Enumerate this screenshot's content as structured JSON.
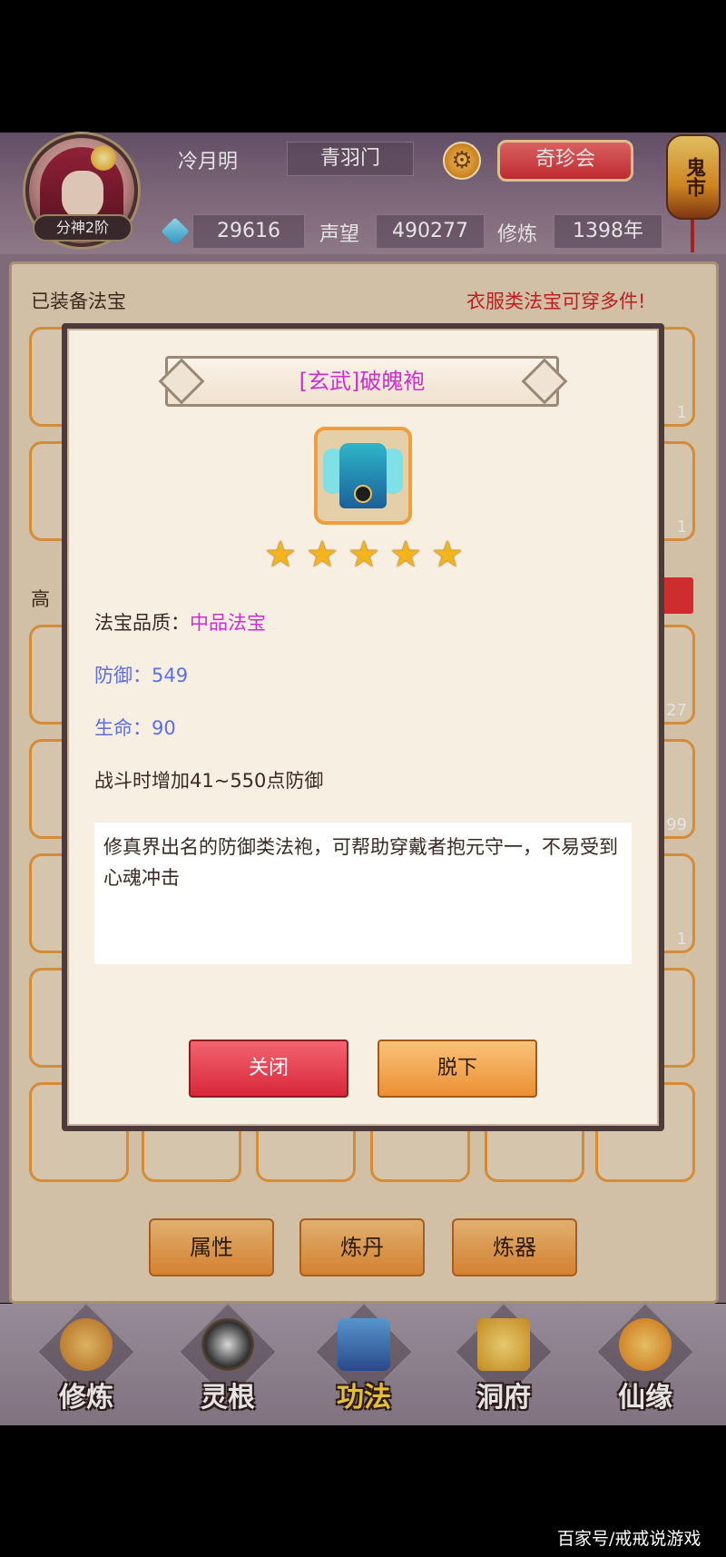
{
  "header": {
    "player_name": "冷月明",
    "sect": "青羽门",
    "rank": "分神2阶",
    "treasure_button": "奇珍会",
    "lantern_text": "鬼市",
    "gems": "29616",
    "reputation_label": "声望",
    "reputation_value": "490277",
    "cultivation_label": "修炼",
    "cultivation_value": "1398年"
  },
  "panel": {
    "equipped_title": "已装备法宝",
    "clothing_note": "衣服类法宝可穿多件!",
    "partial_section_title": "高",
    "slot_counts": [
      "1",
      "1",
      "27",
      "99",
      "1"
    ]
  },
  "dialog": {
    "title": "[玄武]破魄袍",
    "stars": 5,
    "quality_label": "法宝品质：",
    "quality_value": "中品法宝",
    "defense": "防御：549",
    "life": "生命：90",
    "effect": "战斗时增加41~550点防御",
    "description": "修真界出名的防御类法袍，可帮助穿戴者抱元守一，不易受到心魂冲击",
    "close_button": "关闭",
    "remove_button": "脱下"
  },
  "bottom_buttons": [
    "属性",
    "炼丹",
    "炼器"
  ],
  "nav": [
    {
      "label": "修炼",
      "active": false,
      "icon": "monk-icon"
    },
    {
      "label": "灵根",
      "active": false,
      "icon": "spirit-root-icon"
    },
    {
      "label": "功法",
      "active": true,
      "icon": "book-icon"
    },
    {
      "label": "洞府",
      "active": false,
      "icon": "pavilion-icon"
    },
    {
      "label": "仙缘",
      "active": false,
      "icon": "gourd-icon"
    }
  ],
  "watermark": "百家号/戒戒说游戏",
  "colors": {
    "accent_orange": "#ec8f33",
    "close_red": "#d8273a",
    "quality_purple": "#cc2fcf",
    "stat_blue": "#5d6fe0",
    "note_red": "#d12020"
  }
}
